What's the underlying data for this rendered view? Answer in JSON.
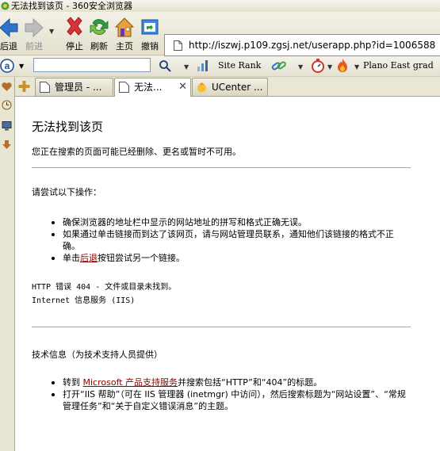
{
  "window": {
    "title": "无法找到该页 - 360安全浏览器"
  },
  "navbar": {
    "back_label": "后退",
    "forward_label": "前进",
    "stop_label": "停止",
    "refresh_label": "刷新",
    "home_label": "主页",
    "undo_label": "撤销"
  },
  "address": {
    "url": "http://iszwj.p109.zgsj.net/userapp.php?id=1006588"
  },
  "linksbar": {
    "search_value": "",
    "site_rank_label": "Site Rank",
    "plano_label": "Plano East grad"
  },
  "tabs": [
    {
      "label": "管理员 - ..."
    },
    {
      "label": "无法...",
      "close": "✕"
    },
    {
      "label": "UCenter ..."
    }
  ],
  "page": {
    "title": "无法找到该页",
    "intro": "您正在搜索的页面可能已经删除、更名或暂时不可用。",
    "try_heading": "请尝试以下操作：",
    "try_items": [
      "确保浏览器的地址栏中显示的网站地址的拼写和格式正确无误。",
      "如果通过单击链接而到达了该网页，请与网站管理员联系，通知他们该链接的格式不正确。"
    ],
    "click_prefix": "单击",
    "back_link": "后退",
    "click_suffix": "按钮尝试另一个链接。",
    "error_line1": "HTTP 错误 404 - 文件或目录未找到。",
    "error_line2": "Internet 信息服务 (IIS)",
    "tech_heading": "技术信息（为技术支持人员提供）",
    "goto_prefix": "转到 ",
    "ms_link": "Microsoft 产品支持服务",
    "goto_suffix": "并搜索包括“HTTP”和“404”的标题。",
    "iis_help": "打开“IIS 帮助”（可在 IIS 管理器 (inetmgr) 中访问），然后搜索标题为“网站设置”、“常规管理任务”和“关于自定义错误消息”的主题。"
  },
  "colors": {
    "link": "#8B0000",
    "chrome": "#ECE9D8",
    "back_arrow": "#2E72C9",
    "stop_x": "#D8323A",
    "refresh": "#2E9C3A"
  }
}
